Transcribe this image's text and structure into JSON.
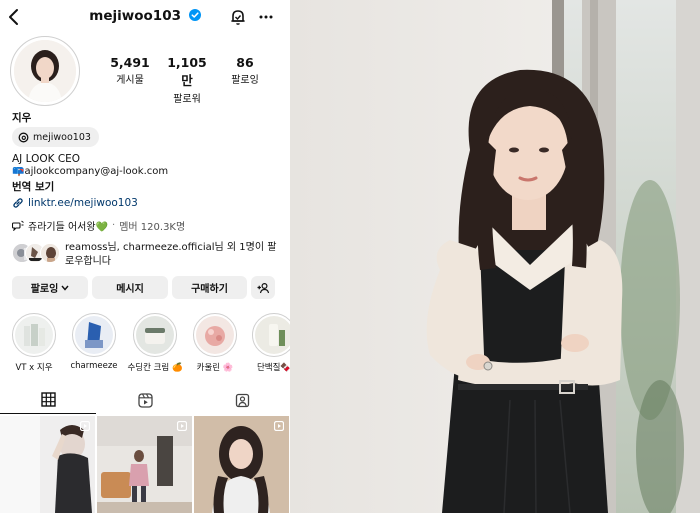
{
  "profile": {
    "username": "mejiwoo103",
    "name": "지우",
    "threads_handle": "mejiwoo103",
    "bio_line1": "AJ LOOK CEO",
    "bio_email": "ajlookcompany@aj-look.com",
    "email_emoji": "📪",
    "translate_label": "번역 보기",
    "link": "linktr.ee/mejiwoo103"
  },
  "stats": [
    {
      "value": "5,491",
      "label": "게시물"
    },
    {
      "value": "1,105만",
      "label": "팔로워"
    },
    {
      "value": "86",
      "label": "팔로잉"
    }
  ],
  "broadcast": {
    "name": "쥬라기들 어서왕💚",
    "separator": "·",
    "members": "멤버 120.3K명"
  },
  "mutual": {
    "text": "reamoss님, charmeeze.official님 외 1명이 팔로우합니다"
  },
  "buttons": {
    "following": "팔로잉",
    "message": "메시지",
    "shop": "구매하기"
  },
  "highlights": [
    {
      "label": "VT x 지우"
    },
    {
      "label": "charmeeze"
    },
    {
      "label": "수딩칸 크림 🍊"
    },
    {
      "label": "카울린 🌸"
    },
    {
      "label": "단백질🍫"
    }
  ],
  "icons": {
    "back": "chevron-left-icon",
    "verified": "verified-badge-icon",
    "notifications": "bell-icon",
    "more": "more-horizontal-icon",
    "threads": "threads-icon",
    "link": "link-icon",
    "broadcast": "broadcast-channel-icon",
    "add_person": "add-person-icon",
    "grid": "grid-icon",
    "reels": "reels-icon",
    "tagged": "tagged-icon"
  },
  "colors": {
    "verified": "#0095f6",
    "link": "#00376b",
    "button_bg": "#efefef"
  }
}
